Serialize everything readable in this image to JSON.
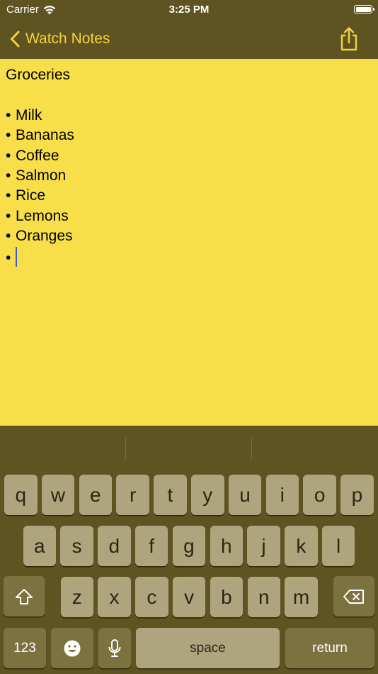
{
  "status_bar": {
    "carrier": "Carrier",
    "time": "3:25 PM",
    "battery_level": 1.0
  },
  "nav": {
    "back_label": "Watch Notes",
    "back_icon": "chevron-left-icon",
    "share_icon": "share-icon"
  },
  "note": {
    "title": "Groceries",
    "bullet": "•",
    "items": [
      "Milk",
      "Bananas",
      "Coffee",
      "Salmon",
      "Rice",
      "Lemons",
      "Oranges"
    ]
  },
  "keyboard": {
    "row1": [
      "q",
      "w",
      "e",
      "r",
      "t",
      "y",
      "u",
      "i",
      "o",
      "p"
    ],
    "row2": [
      "a",
      "s",
      "d",
      "f",
      "g",
      "h",
      "j",
      "k",
      "l"
    ],
    "row3": [
      "z",
      "x",
      "c",
      "v",
      "b",
      "n",
      "m"
    ],
    "numbers_label": "123",
    "space_label": "space",
    "return_label": "return",
    "shift_icon": "shift-icon",
    "delete_icon": "delete-icon",
    "emoji_icon": "emoji-icon",
    "mic_icon": "microphone-icon"
  },
  "colors": {
    "note_background": "#f8de49",
    "chrome": "#5f5421",
    "accent": "#f2d43a",
    "key": "#aea57f",
    "cursor": "#3a5ccc"
  }
}
